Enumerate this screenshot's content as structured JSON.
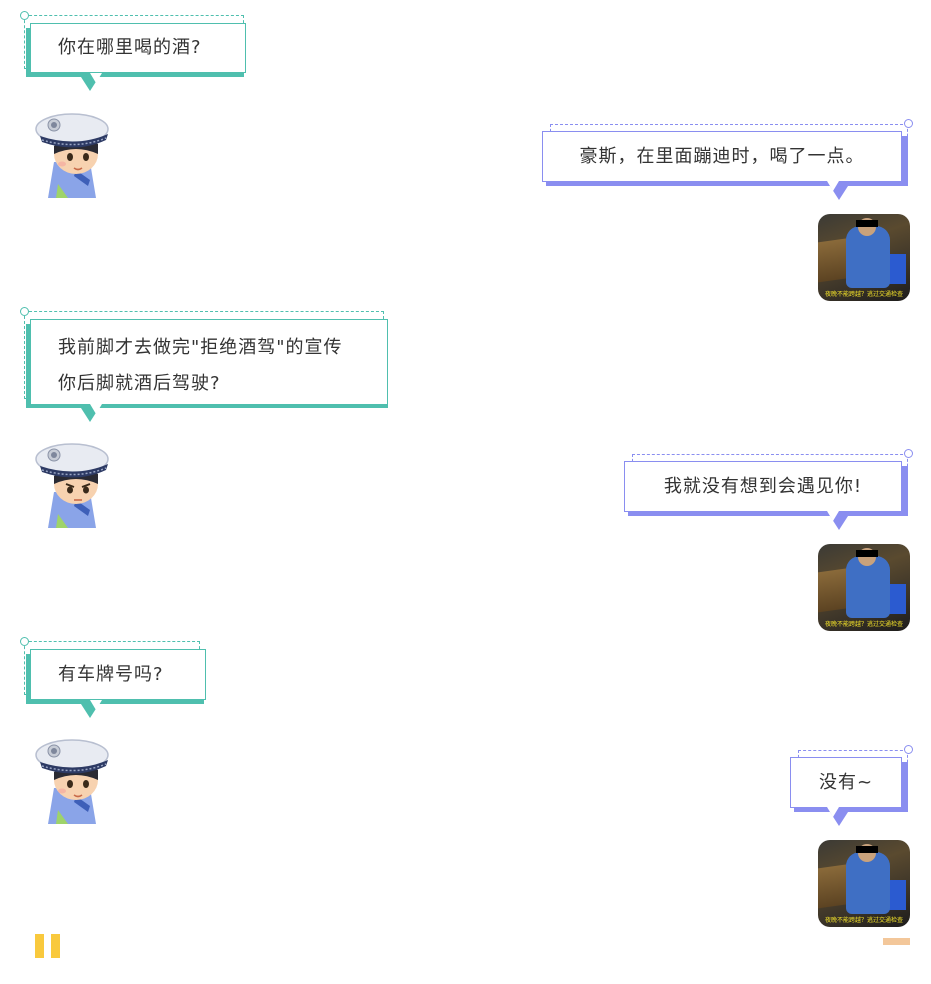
{
  "messages": [
    {
      "side": "officer",
      "text": "你在哪里喝的酒?"
    },
    {
      "side": "driver",
      "text": "豪斯，在里面蹦迪时，喝了一点。"
    },
    {
      "side": "officer",
      "line1": "我前脚才去做完\"拒绝酒驾\"的宣传",
      "line2": "你后脚就酒后驾驶?"
    },
    {
      "side": "driver",
      "text": "我就没有想到会遇见你!"
    },
    {
      "side": "officer",
      "text": "有车牌号吗?"
    },
    {
      "side": "driver",
      "text": "没有~"
    }
  ],
  "thumbnail_caption": "夜晚不能跨越？逃过交通检查",
  "icons": {
    "officer": "police-officer-avatar-icon",
    "driver": "driver-photo-thumbnail",
    "pause": "pause-icon"
  },
  "colors": {
    "officer_accent": "#4fbfae",
    "driver_accent": "#8a8ef0",
    "pause": "#f9c93d",
    "end_bar": "#f3c79a"
  }
}
